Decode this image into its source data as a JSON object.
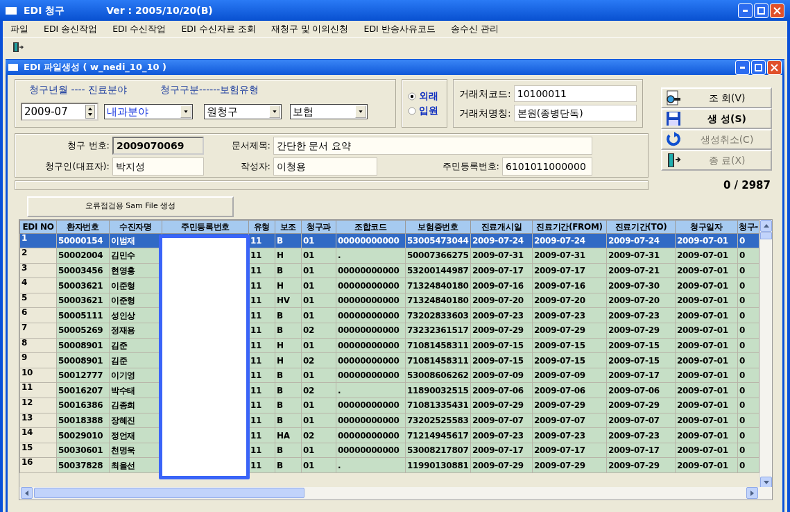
{
  "window": {
    "title": "EDI 청구",
    "version": "Ver : 2005/10/20(B)"
  },
  "menu": [
    "파일",
    "EDI 송신작업",
    "EDI 수신작업",
    "EDI 수신자료 조회",
    "재청구 및 이의신청",
    "EDI 반송사유코드",
    "송수신 관리"
  ],
  "child_window": {
    "title": "EDI 파일생성 ( w_nedi_10_10 )"
  },
  "filter": {
    "legend_left": "청구년월 ---- 진료분야",
    "legend_right": "청구구분------보험유형",
    "month": "2009-07",
    "field": "내과분야",
    "claim_type": "원청구",
    "insurance": "보험"
  },
  "visit_types": [
    {
      "label": "외래",
      "selected": true
    },
    {
      "label": "입원",
      "selected": false
    }
  ],
  "vendor": {
    "code_label": "거래처코드:",
    "code": "10100011",
    "name_label": "거래처명칭:",
    "name": "본원(종병단독)"
  },
  "info": [
    {
      "label": "청구 번호:",
      "value": "2009070069",
      "readonly": true
    },
    {
      "label": "문서제목:",
      "value": "간단한 문서 요약",
      "readonly": false
    },
    {
      "label": "청구인(대표자):",
      "value": "박지성",
      "readonly": false
    },
    {
      "label": "작성자:",
      "value": "이청용",
      "readonly": false
    },
    {
      "label": "주민등록번호:",
      "value": "6101011000000",
      "readonly": false
    }
  ],
  "buttons": [
    {
      "label": "조 회(V)",
      "kind": "view",
      "disabled": false,
      "default": false
    },
    {
      "label": "생 성(S)",
      "kind": "save",
      "disabled": false,
      "default": true
    },
    {
      "label": "생성취소(C)",
      "kind": "undo",
      "disabled": true,
      "default": false
    },
    {
      "label": "종 료(X)",
      "kind": "exit",
      "disabled": true,
      "default": false
    }
  ],
  "counter": "0 / 2987",
  "sam_button": "오류점검용 Sam File 생성",
  "table": {
    "columns": [
      "EDI NO",
      "환자번호",
      "수진자명",
      "주민등록번호",
      "유형",
      "보조",
      "청구과",
      "조합코드",
      "보험증번호",
      "진료개시일",
      "진료기간(FROM)",
      "진료기간(TO)",
      "청구일자",
      "청구-"
    ],
    "rows": [
      {
        "selected": true,
        "cells": [
          "1",
          "50000154",
          "이범재",
          "",
          "11",
          "B",
          "01",
          "00000000000",
          "53005473044",
          "2009-07-24",
          "2009-07-24",
          "2009-07-24",
          "2009-07-01",
          "0"
        ]
      },
      {
        "selected": false,
        "cells": [
          "2",
          "50002004",
          "김민수",
          "",
          "11",
          "H",
          "01",
          ".",
          "50007366275",
          "2009-07-31",
          "2009-07-31",
          "2009-07-31",
          "2009-07-01",
          "0"
        ]
      },
      {
        "selected": false,
        "cells": [
          "3",
          "50003456",
          "현영홍",
          "",
          "11",
          "B",
          "01",
          "00000000000",
          "53200144987",
          "2009-07-17",
          "2009-07-17",
          "2009-07-21",
          "2009-07-01",
          "0"
        ]
      },
      {
        "selected": false,
        "cells": [
          "4",
          "50003621",
          "이준형",
          "",
          "11",
          "H",
          "01",
          "00000000000",
          "71324840180",
          "2009-07-16",
          "2009-07-16",
          "2009-07-30",
          "2009-07-01",
          "0"
        ]
      },
      {
        "selected": false,
        "cells": [
          "5",
          "50003621",
          "이준형",
          "",
          "11",
          "HV",
          "01",
          "00000000000",
          "71324840180",
          "2009-07-20",
          "2009-07-20",
          "2009-07-20",
          "2009-07-01",
          "0"
        ]
      },
      {
        "selected": false,
        "cells": [
          "6",
          "50005111",
          "성인상",
          "",
          "11",
          "B",
          "01",
          "00000000000",
          "73202833603",
          "2009-07-23",
          "2009-07-23",
          "2009-07-23",
          "2009-07-01",
          "0"
        ]
      },
      {
        "selected": false,
        "cells": [
          "7",
          "50005269",
          "정재용",
          "",
          "11",
          "B",
          "02",
          "00000000000",
          "73232361517",
          "2009-07-29",
          "2009-07-29",
          "2009-07-29",
          "2009-07-01",
          "0"
        ]
      },
      {
        "selected": false,
        "cells": [
          "8",
          "50008901",
          "김준",
          "",
          "11",
          "H",
          "01",
          "00000000000",
          "71081458311",
          "2009-07-15",
          "2009-07-15",
          "2009-07-15",
          "2009-07-01",
          "0"
        ]
      },
      {
        "selected": false,
        "cells": [
          "9",
          "50008901",
          "김준",
          "",
          "11",
          "H",
          "02",
          "00000000000",
          "71081458311",
          "2009-07-15",
          "2009-07-15",
          "2009-07-15",
          "2009-07-01",
          "0"
        ]
      },
      {
        "selected": false,
        "cells": [
          "10",
          "50012777",
          "이기영",
          "",
          "11",
          "B",
          "01",
          "00000000000",
          "53008606262",
          "2009-07-09",
          "2009-07-09",
          "2009-07-17",
          "2009-07-01",
          "0"
        ]
      },
      {
        "selected": false,
        "cells": [
          "11",
          "50016207",
          "박수태",
          "",
          "11",
          "B",
          "02",
          ".",
          "11890032515",
          "2009-07-06",
          "2009-07-06",
          "2009-07-06",
          "2009-07-01",
          "0"
        ]
      },
      {
        "selected": false,
        "cells": [
          "12",
          "50016386",
          "김종희",
          "",
          "11",
          "B",
          "01",
          "00000000000",
          "71081335431",
          "2009-07-29",
          "2009-07-29",
          "2009-07-29",
          "2009-07-01",
          "0"
        ]
      },
      {
        "selected": false,
        "cells": [
          "13",
          "50018388",
          "장혜진",
          "",
          "11",
          "B",
          "01",
          "00000000000",
          "73202525583",
          "2009-07-07",
          "2009-07-07",
          "2009-07-07",
          "2009-07-01",
          "0"
        ]
      },
      {
        "selected": false,
        "cells": [
          "14",
          "50029010",
          "정언재",
          "",
          "11",
          "HA",
          "02",
          "00000000000",
          "71214945617",
          "2009-07-23",
          "2009-07-23",
          "2009-07-23",
          "2009-07-01",
          "0"
        ]
      },
      {
        "selected": false,
        "cells": [
          "15",
          "50030601",
          "천명욱",
          "",
          "11",
          "B",
          "01",
          "00000000000",
          "53008217807",
          "2009-07-17",
          "2009-07-17",
          "2009-07-17",
          "2009-07-01",
          "0"
        ]
      },
      {
        "selected": false,
        "cells": [
          "16",
          "50037828",
          "최을선",
          "",
          "11",
          "B",
          "01",
          ".",
          "11990130881",
          "2009-07-29",
          "2009-07-29",
          "2009-07-29",
          "2009-07-01",
          "0"
        ]
      }
    ]
  }
}
